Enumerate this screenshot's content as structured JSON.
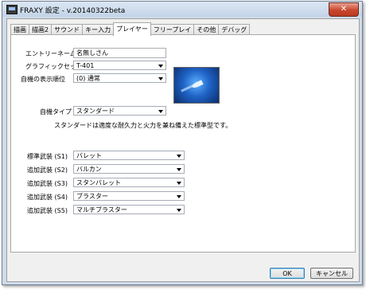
{
  "window": {
    "title": "FRAXY 設定 - v.20140322beta",
    "close_label": "✕"
  },
  "tabs": [
    {
      "label": "描画",
      "active": false
    },
    {
      "label": "描画2",
      "active": false
    },
    {
      "label": "サウンド",
      "active": false
    },
    {
      "label": "キー入力",
      "active": false
    },
    {
      "label": "プレイヤー",
      "active": true
    },
    {
      "label": "フリープレイ",
      "active": false
    },
    {
      "label": "その他",
      "active": false
    },
    {
      "label": "デバッグ",
      "active": false
    }
  ],
  "player": {
    "entry_name": {
      "label": "エントリーネーム",
      "value": "名無しさん"
    },
    "graphic_set": {
      "label": "グラフィックセット",
      "value": "T-401"
    },
    "display_order": {
      "label": "自機の表示順位",
      "value": "(0) 通常"
    },
    "ship_type": {
      "label": "自機タイプ",
      "value": "スタンダード"
    },
    "description": "スタンダードは適度な耐久力と火力を兼ね備えた標準型です。"
  },
  "weapons": [
    {
      "label": "標準武装 (S1)",
      "value": "バレット"
    },
    {
      "label": "追加武装 (S2)",
      "value": "バルカン"
    },
    {
      "label": "追加武装 (S3)",
      "value": "スタンバレット"
    },
    {
      "label": "追加武装 (S4)",
      "value": "ブラスター"
    },
    {
      "label": "追加武装 (S5)",
      "value": "マルチブラスター"
    }
  ],
  "buttons": {
    "ok": "OK",
    "cancel": "キャンセル"
  }
}
